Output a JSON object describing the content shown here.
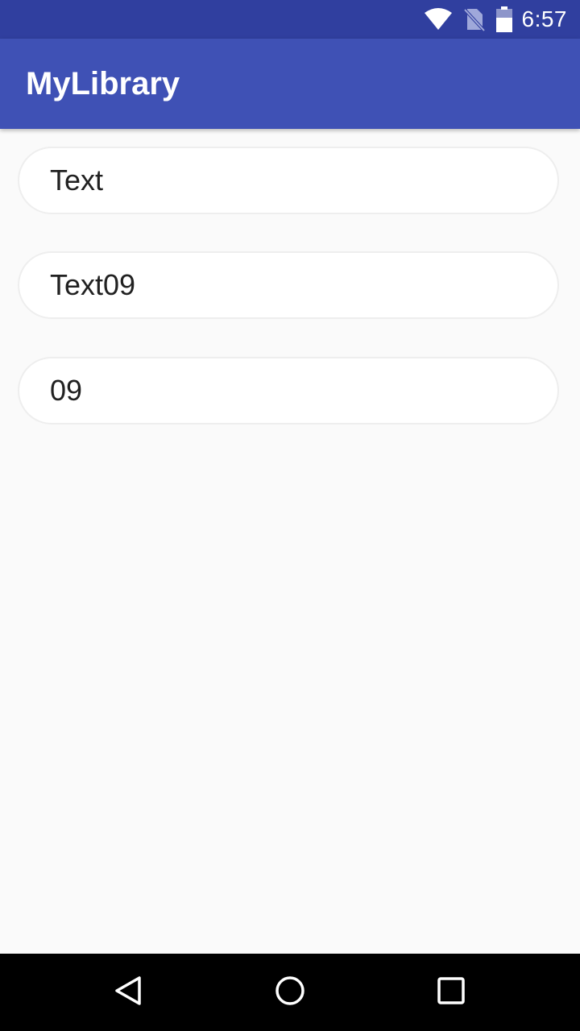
{
  "status_bar": {
    "time": "6:57",
    "icons": [
      "wifi-icon",
      "no-sim-icon",
      "battery-icon"
    ],
    "background": "#303f9f"
  },
  "app_bar": {
    "title": "MyLibrary",
    "background": "#3f51b5"
  },
  "items": [
    {
      "text": "Text"
    },
    {
      "text": "Text09"
    },
    {
      "text": "09"
    }
  ],
  "nav_bar": {
    "buttons": [
      "back-icon",
      "home-icon",
      "recents-icon"
    ],
    "background": "#000000"
  }
}
